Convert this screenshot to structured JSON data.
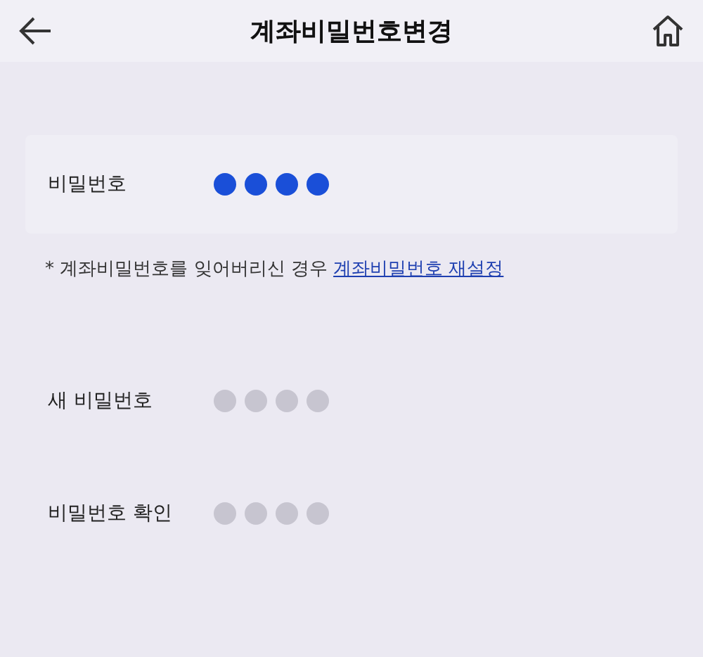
{
  "header": {
    "title": "계좌비밀번호변경"
  },
  "fields": [
    {
      "label": "비밀번호",
      "dots": [
        {
          "filled": true
        },
        {
          "filled": true
        },
        {
          "filled": true
        },
        {
          "filled": true
        }
      ]
    },
    {
      "label": "새 비밀번호",
      "dots": [
        {
          "filled": false
        },
        {
          "filled": false
        },
        {
          "filled": false
        },
        {
          "filled": false
        }
      ]
    },
    {
      "label": "비밀번호 확인",
      "dots": [
        {
          "filled": false
        },
        {
          "filled": false
        },
        {
          "filled": false
        },
        {
          "filled": false
        }
      ]
    }
  ],
  "note": {
    "text": "* 계좌비밀번호를 잊어버리신 경우",
    "link": "계좌비밀번호 재설정"
  }
}
